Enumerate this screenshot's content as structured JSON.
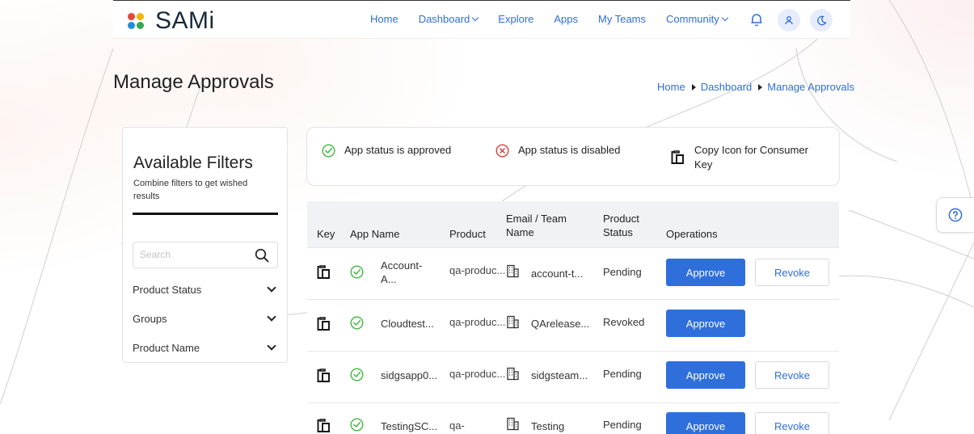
{
  "brand": {
    "name": "SAMi",
    "dot_colors": [
      "#e8453c",
      "#f5b400",
      "#1f8fe0",
      "#34a853"
    ]
  },
  "nav": {
    "items": [
      {
        "label": "Home",
        "dropdown": false
      },
      {
        "label": "Dashboard",
        "dropdown": true
      },
      {
        "label": "Explore",
        "dropdown": false
      },
      {
        "label": "Apps",
        "dropdown": false
      },
      {
        "label": "My Teams",
        "dropdown": false
      },
      {
        "label": "Community",
        "dropdown": true
      }
    ],
    "icons": [
      "bell-icon",
      "user-icon",
      "moon-icon"
    ]
  },
  "page": {
    "title": "Manage Approvals",
    "breadcrumb": [
      "Home",
      "Dashboard",
      "Manage Approvals"
    ]
  },
  "filters": {
    "title": "Available Filters",
    "subtitle": "Combine filters to get wished results",
    "search_placeholder": "Search",
    "groups": [
      "Product Status",
      "Groups",
      "Product Name"
    ]
  },
  "legend": {
    "approved": "App status is approved",
    "disabled": "App status is disabled",
    "copy": "Copy Icon for Consumer Key"
  },
  "table": {
    "headers": {
      "key": "Key",
      "app_name": "App Name",
      "product": "Product",
      "email_team": "Email / Team Name",
      "product_status": "Product Status",
      "operations": "Operations"
    },
    "rows": [
      {
        "app_name": "Account-A...",
        "product": "qa-produc...",
        "team": "account-t...",
        "status": "Pending",
        "approve": "Approve",
        "revoke": "Revoke"
      },
      {
        "app_name": "Cloudtest...",
        "product": "qa-produc...",
        "team": "QArelease...",
        "status": "Revoked",
        "approve": "Approve",
        "revoke": null
      },
      {
        "app_name": "sidgsapp0...",
        "product": "qa-produc...",
        "team": "sidgsteam...",
        "status": "Pending",
        "approve": "Approve",
        "revoke": "Revoke"
      },
      {
        "app_name": "TestingSC...",
        "product": "qa-",
        "team": "Testing",
        "status": "Pending",
        "approve": "Approve",
        "revoke": "Revoke"
      }
    ]
  },
  "colors": {
    "accent": "#2f6fdc",
    "success": "#3fb83f",
    "danger": "#e23b3b"
  }
}
